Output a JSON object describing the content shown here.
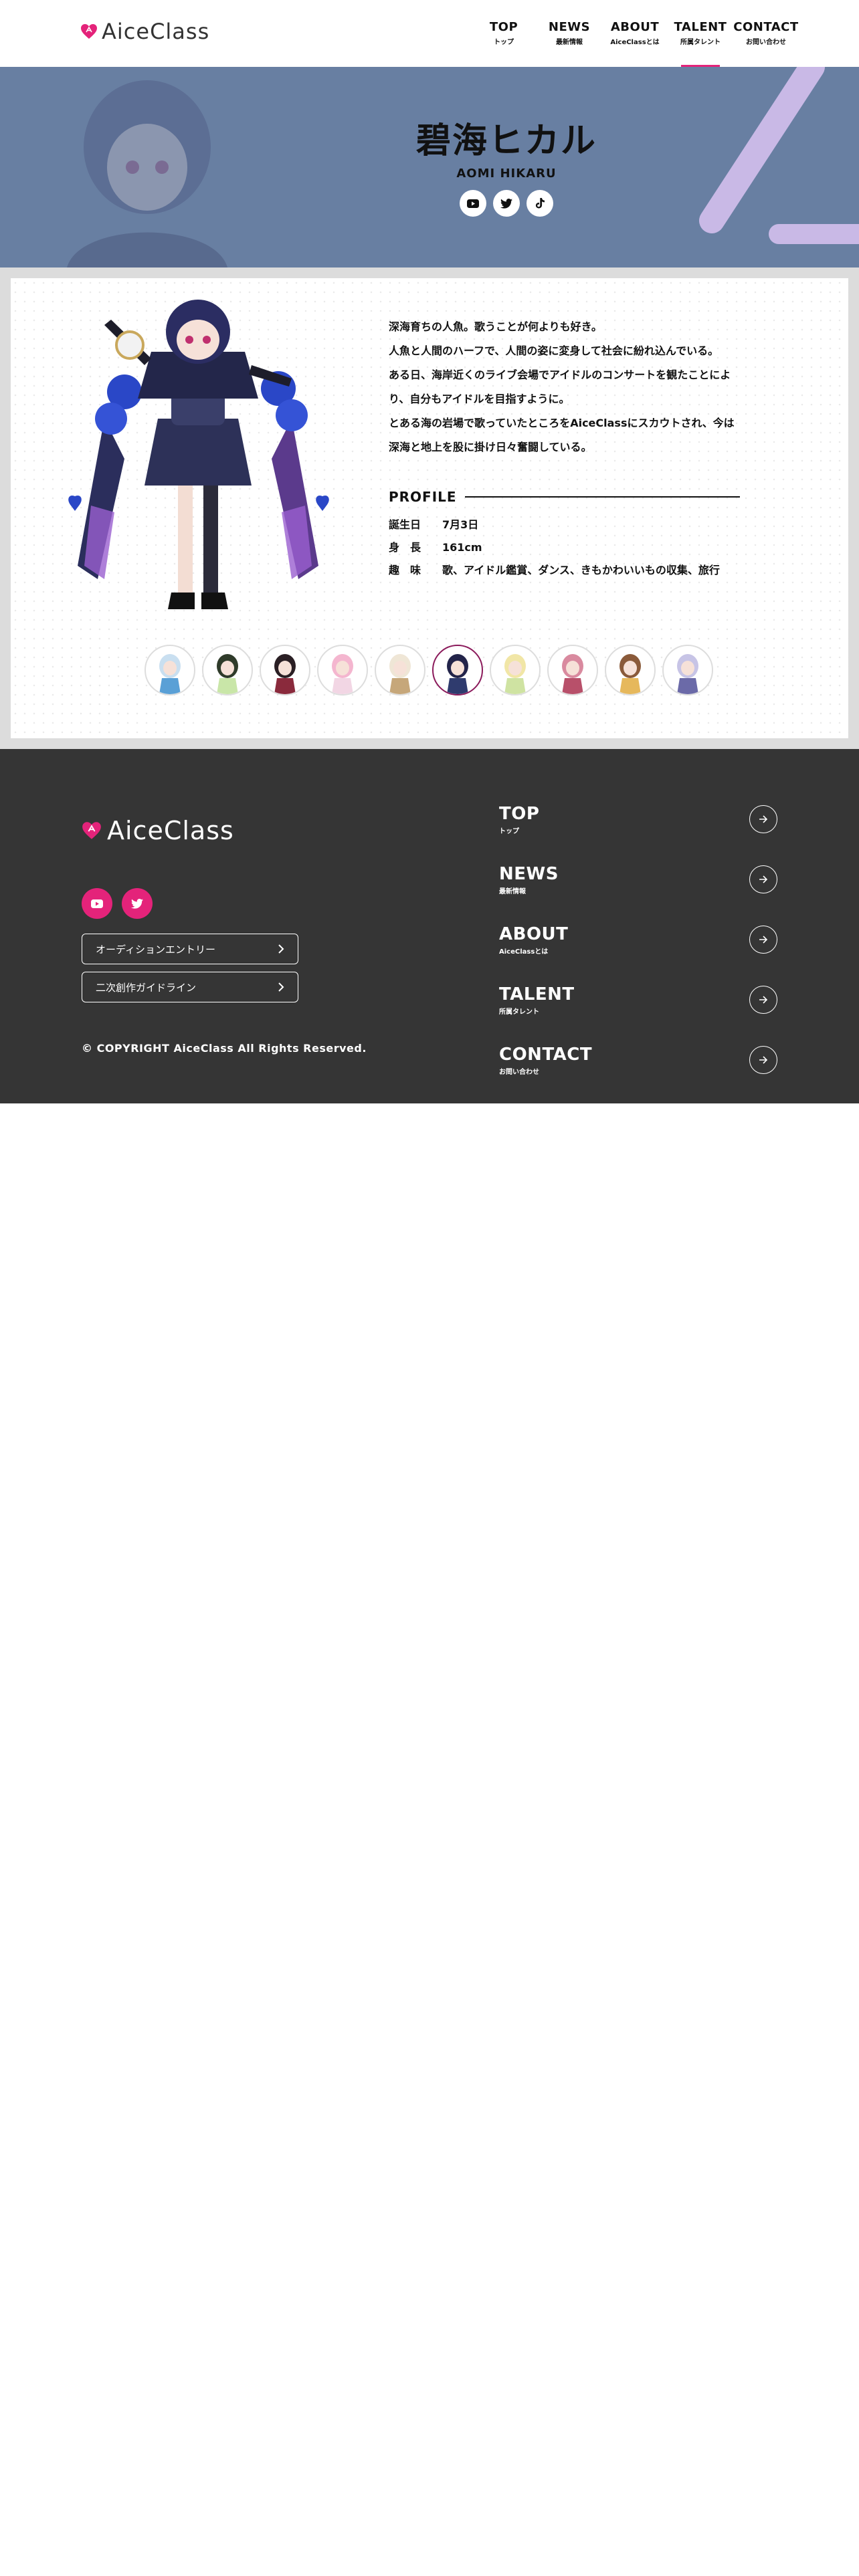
{
  "brand": {
    "logo_text": "AiceClass",
    "accent_color": "#e4237a"
  },
  "nav": {
    "items": [
      {
        "en": "TOP",
        "jp": "トップ",
        "active": false
      },
      {
        "en": "NEWS",
        "jp": "最新情報",
        "active": false
      },
      {
        "en": "ABOUT",
        "jp": "AiceClassとは",
        "active": false
      },
      {
        "en": "TALENT",
        "jp": "所属タレント",
        "active": true
      },
      {
        "en": "CONTACT",
        "jp": "お問い合わせ",
        "active": false
      }
    ]
  },
  "hero": {
    "name": "碧海ヒカル",
    "romaji": "AOMI HIKARU",
    "sns": [
      "youtube-icon",
      "twitter-icon",
      "tiktok-icon"
    ],
    "bg_color": "#687fa2",
    "slash_color": "#c9b9e6"
  },
  "profile": {
    "description": [
      "深海育ちの人魚。歌うことが何よりも好き。",
      "人魚と人間のハーフで、人間の姿に変身して社会に紛れ込んでいる。",
      "ある日、海岸近くのライブ会場でアイドルのコンサートを観たことによ",
      "り、自分もアイドルを目指すように。",
      "とある海の岩場で歌っていたところをAiceClassにスカウトされ、今は",
      "深海と地上を股に掛け日々奮闘している。"
    ],
    "heading": "PROFILE",
    "rows": [
      {
        "key": "誕生日",
        "value": "7月3日"
      },
      {
        "key": "身　長",
        "value": "161cm"
      },
      {
        "key": "趣　味",
        "value": "歌、アイドル鑑賞、ダンス、きもかわいいもの収集、旅行"
      }
    ]
  },
  "talents": {
    "thumbnails": [
      {
        "hair": "#c9dff0",
        "outfit": "#5aa0d6",
        "active": false
      },
      {
        "hair": "#2f3b2a",
        "outfit": "#c9e6a8",
        "active": false
      },
      {
        "hair": "#2a1f24",
        "outfit": "#8a2a3c",
        "active": false
      },
      {
        "hair": "#f4b6cf",
        "outfit": "#f2d6e4",
        "active": false
      },
      {
        "hair": "#efe6d6",
        "outfit": "#c6a77a",
        "active": false
      },
      {
        "hair": "#23244a",
        "outfit": "#2f3b6e",
        "active": true
      },
      {
        "hair": "#f1e6a6",
        "outfit": "#cfe3a2",
        "active": false
      },
      {
        "hair": "#d98a9f",
        "outfit": "#b8506a",
        "active": false
      },
      {
        "hair": "#8a5a3a",
        "outfit": "#e6b85c",
        "active": false
      },
      {
        "hair": "#c7c4e6",
        "outfit": "#6b6aa8",
        "active": false
      }
    ]
  },
  "footer": {
    "sns": [
      "youtube-icon",
      "twitter-icon"
    ],
    "buttons": [
      "オーディションエントリー",
      "二次創作ガイドライン"
    ],
    "copyright": "© COPYRIGHT AiceClass All Rights Reserved.",
    "nav": [
      {
        "en": "TOP",
        "jp": "トップ"
      },
      {
        "en": "NEWS",
        "jp": "最新情報"
      },
      {
        "en": "ABOUT",
        "jp": "AiceClassとは"
      },
      {
        "en": "TALENT",
        "jp": "所属タレント"
      },
      {
        "en": "CONTACT",
        "jp": "お問い合わせ"
      }
    ]
  }
}
